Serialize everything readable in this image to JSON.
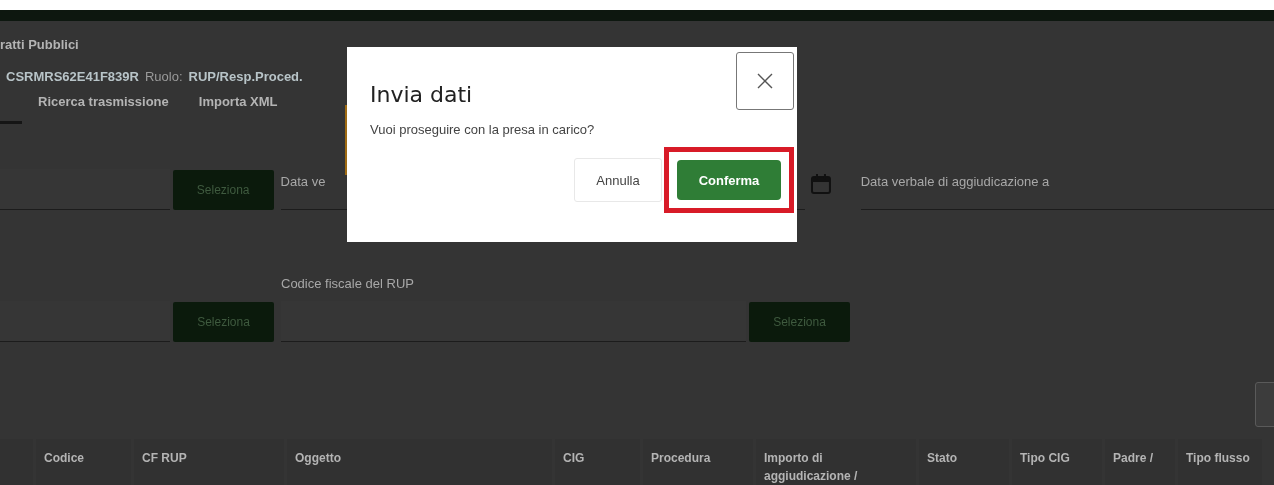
{
  "app_title": "ratti Pubblici",
  "user": {
    "code": "CSRMRS62E41F839R",
    "role_label": "Ruolo:",
    "role": "RUP/Resp.Proced."
  },
  "tabs": [
    {
      "label": "Ricerca trasmissione",
      "selected": false
    },
    {
      "label": "Importa XML",
      "selected": false
    }
  ],
  "filters": {
    "row1": {
      "left_button": "Seleziona",
      "date_from_label": "Data ve",
      "date_to_label": "Data verbale di aggiudicazione a"
    },
    "row2": {
      "left_button": "Seleziona",
      "rup_label": "Codice fiscale del RUP",
      "rup_button": "Seleziona"
    }
  },
  "table": {
    "columns": [
      "Codice",
      "CF RUP",
      "Oggetto",
      "CIG",
      "Procedura",
      "Importo di aggiudicazione /",
      "Stato",
      "Tipo CIG",
      "Padre /",
      "Tipo flusso"
    ]
  },
  "modal": {
    "title": "Invia dati",
    "message": "Vuoi proseguire con la presa in carico?",
    "cancel": "Annulla",
    "confirm": "Conferma",
    "confirm_highlighted": true
  }
}
